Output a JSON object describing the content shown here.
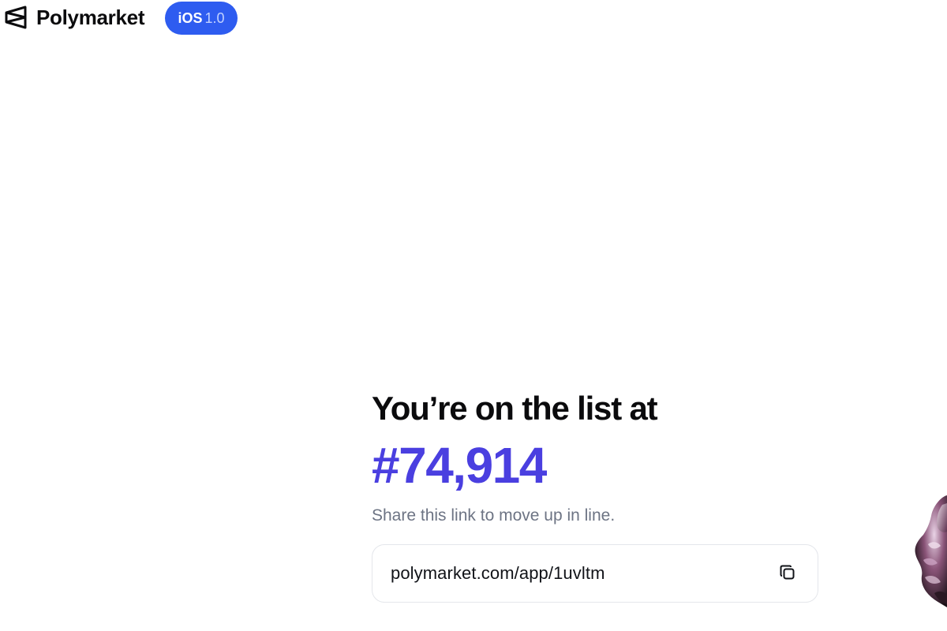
{
  "header": {
    "brand_name": "Polymarket",
    "badge": {
      "platform": "iOS",
      "version": "1.0"
    }
  },
  "waitlist": {
    "heading": "You’re on the list at",
    "position": "#74,914",
    "hint": "Share this link to move up in line.",
    "share_link": "polymarket.com/app/1uvltm"
  },
  "icons": {
    "logo": "polymarket-logo-icon",
    "copy": "copy-icon"
  },
  "colors": {
    "badge_bg": "#2e5cf0",
    "position_accent": "#4a3fe0",
    "hint_text": "#6d7484"
  }
}
